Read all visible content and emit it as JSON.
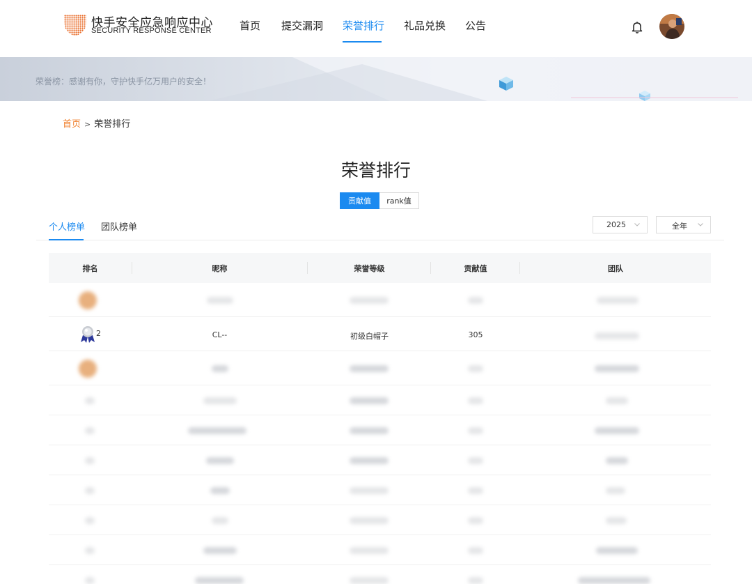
{
  "header": {
    "logo_cn": "快手安全应急响应中心",
    "logo_en": "SECURITY RESPONSE CENTER",
    "nav": [
      {
        "label": "首页"
      },
      {
        "label": "提交漏洞"
      },
      {
        "label": "荣誉排行",
        "active": true
      },
      {
        "label": "礼品兑换"
      },
      {
        "label": "公告"
      }
    ]
  },
  "banner": {
    "text": "荣誉榜：感谢有你，守护快手亿万用户的安全！"
  },
  "breadcrumb": {
    "home": "首页",
    "sep": ">",
    "current": "荣誉排行"
  },
  "page": {
    "title": "荣誉排行"
  },
  "toggle": {
    "options": [
      "贡献值",
      "rank值"
    ],
    "selected": "贡献值"
  },
  "tabs": {
    "items": [
      "个人榜单",
      "团队榜单"
    ],
    "active": "个人榜单"
  },
  "filters": {
    "year": "2025",
    "range": "全年"
  },
  "table": {
    "columns": [
      "排名",
      "昵称",
      "荣誉等级",
      "贡献值",
      "团队"
    ],
    "visible_row": {
      "rank": "2",
      "nickname": "CL--",
      "level": "初级白帽子",
      "contribution": "305"
    }
  },
  "colors": {
    "accent": "#1b8af0",
    "breadcrumb_home": "#f07f2c",
    "banner_text": "#8a94a3"
  },
  "icons": [
    "shield-logo-icon",
    "bell-icon",
    "silver-medal-icon",
    "chevron-down-icon"
  ]
}
